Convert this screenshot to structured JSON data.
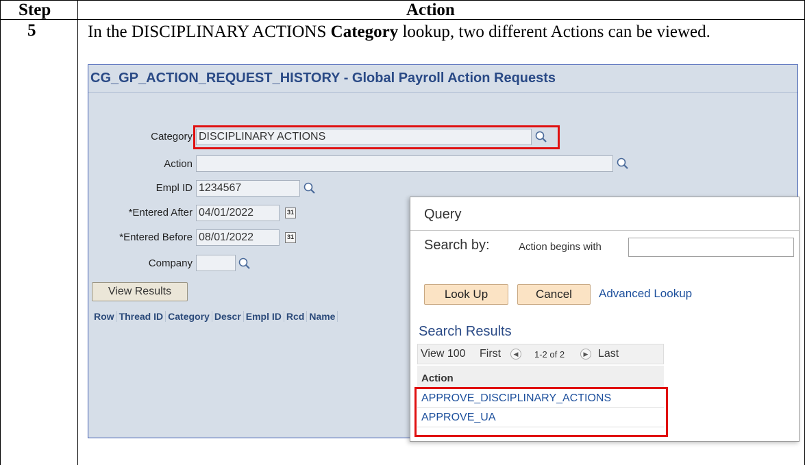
{
  "table": {
    "header_step": "Step",
    "header_action": "Action",
    "step_number": "5",
    "instruction_pre": "In the DISCIPLINARY ACTIONS ",
    "instruction_bold": "Category",
    "instruction_post": " lookup, two different Actions can be viewed."
  },
  "screenshot": {
    "title": "CG_GP_ACTION_REQUEST_HISTORY - Global Payroll Action Requests",
    "fields": {
      "category_label": "Category",
      "category_value": "DISCIPLINARY ACTIONS",
      "action_label": "Action",
      "action_value": "",
      "emplid_label": "Empl ID",
      "emplid_value": "1234567",
      "entered_after_label": "*Entered After",
      "entered_after_value": "04/01/2022",
      "entered_before_label": "*Entered Before",
      "entered_before_value": "08/01/2022",
      "company_label": "Company",
      "company_value": ""
    },
    "view_results_label": "View Results",
    "grid_columns": [
      "Row",
      "Thread ID",
      "Category",
      "Descr",
      "Empl ID",
      "Rcd",
      "Name"
    ],
    "calendar_glyph": "31"
  },
  "lookup": {
    "title": "Query",
    "search_by_label": "Search by:",
    "criteria_label": "Action begins with",
    "criteria_value": "",
    "lookup_button": "Look Up",
    "cancel_button": "Cancel",
    "advanced_link": "Advanced Lookup",
    "results_heading": "Search Results",
    "nav": {
      "view_label": "View 100",
      "first_label": "First",
      "range_label": "1-2 of 2",
      "last_label": "Last"
    },
    "column_header": "Action",
    "results": [
      "APPROVE_DISCIPLINARY_ACTIONS",
      "APPROVE_UA"
    ]
  },
  "colors": {
    "highlight": "#e01010",
    "panel_bg": "#d6dee8",
    "title_blue": "#2a4a86",
    "button_bg": "#fbe3c4"
  }
}
